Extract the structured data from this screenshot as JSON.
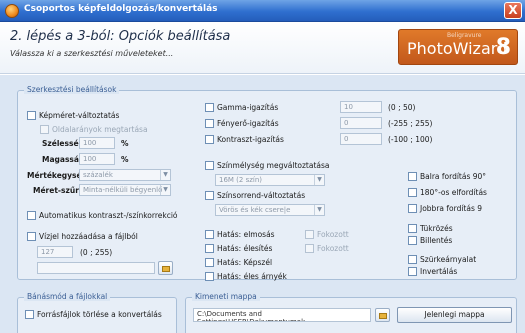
{
  "window": {
    "title": "Csoportos képfeldolgozás/konvertálás",
    "close": "X"
  },
  "header": {
    "step_title": "2. lépés a 3-ból: Opciók beállítása",
    "step_subtitle": "Válassza ki a szerkesztési műveleteket...",
    "logo_brand": "PhotoWizard",
    "logo_version": "8",
    "logo_tag": "Beligravure"
  },
  "edit_settings": {
    "legend": "Szerkesztési beállítások",
    "resize": {
      "label": "Képméret-változtatás",
      "keep_ratio": "Oldalarányok megtartása",
      "width_label": "Szélesség:",
      "width_value": "100",
      "width_unit": "%",
      "height_label": "Magasság:",
      "height_value": "100",
      "height_unit": "%",
      "unit_label": "Mértékegység:",
      "unit_value": "százalék",
      "filter_label": "Méret-szűrő:",
      "filter_value": "Minta-nélküli bégyenlő"
    },
    "auto_contrast": "Automatikus kontraszt-/színkorrekció",
    "watermark": {
      "label": "Vízjel hozzáadása a fájlból",
      "value": "127",
      "range": "(0 ; 255)"
    },
    "gamma": {
      "label": "Gamma-igazítás",
      "value": "10",
      "range": "(0 ; 50)"
    },
    "brightness": {
      "label": "Fényerő-igazítás",
      "value": "0",
      "range": "(-255 ; 255)"
    },
    "contrast": {
      "label": "Kontraszt-igazítás",
      "value": "0",
      "range": "(-100 ; 100)"
    },
    "color_depth": {
      "label": "Színmélység megváltoztatása",
      "value": "16M (2 szín)"
    },
    "color_order": {
      "label": "Színsorrend-változtatás",
      "value": "Vörös és kék csere|e"
    },
    "effects": {
      "emboss": "Hatás: elmosás",
      "focus": "Fokozott",
      "sharpen": "Hatás: élesítés",
      "focus2": "Fokozott",
      "painting": "Hatás: Képszél",
      "edges": "Hatás: éles árnyék"
    },
    "rotations": {
      "left": "Balra fordítás 90°",
      "r180": "180°-os elfordítás",
      "right": "Jobbra fordítás 9"
    },
    "mirror": "Tükrözés",
    "flip": "Billentés",
    "grayscale": "Szürkeárnyalat",
    "invert": "Invertálás"
  },
  "file_handling": {
    "legend": "Bánásmód a fájlokkal",
    "delete_sources": "Forrásfájlok törlése a konvertálás"
  },
  "output_folder": {
    "legend": "Kimeneti mappa",
    "path": "C:\\Documents and Settings\\USER\\Dokumentumok",
    "current_folder_btn": "Jelenlegi mappa"
  }
}
